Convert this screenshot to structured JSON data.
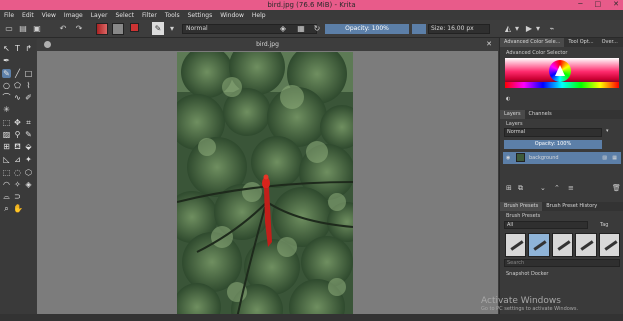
{
  "window": {
    "title": "bird.jpg (76.6 MiB) - Krita",
    "minimize": "─",
    "maximize": "□",
    "close": "✕"
  },
  "menu": [
    "File",
    "Edit",
    "View",
    "Image",
    "Layer",
    "Select",
    "Filter",
    "Tools",
    "Settings",
    "Window",
    "Help"
  ],
  "toolbar": {
    "blend_mode": "Normal",
    "opacity_label": "Opacity: 100%",
    "size_label": "Size: 16.00 px"
  },
  "document": {
    "tab_name": "bird.jpg",
    "close_glyph": "✕"
  },
  "dock": {
    "tabs": [
      "Advanced Color Sele...",
      "Tool Opt...",
      "Over..."
    ],
    "color_selector_title": "Advanced Color Selector",
    "layers_tabs": [
      "Layers",
      "Channels"
    ],
    "layers_title": "Layers",
    "layer_blend": "Normal",
    "layer_opacity": "Opacity: 100%",
    "layer_name": "background",
    "brush_tabs": [
      "Brush Presets",
      "Brush Preset History"
    ],
    "brush_presets_title": "Brush Presets",
    "filter_value": "All",
    "tag_label": "Tag",
    "search_placeholder": "Search",
    "snapshot_title": "Snapshot Docker"
  },
  "watermark": {
    "title": "Activate Windows",
    "subtitle": "Go to PC settings to activate Windows."
  },
  "colors": {
    "titlebar": "#e85b8a",
    "accent": "#5c7fa8",
    "canvas_bg": "#7c7c7c",
    "foreground_swatch": "#cc3333",
    "background_swatch": "#888888"
  }
}
